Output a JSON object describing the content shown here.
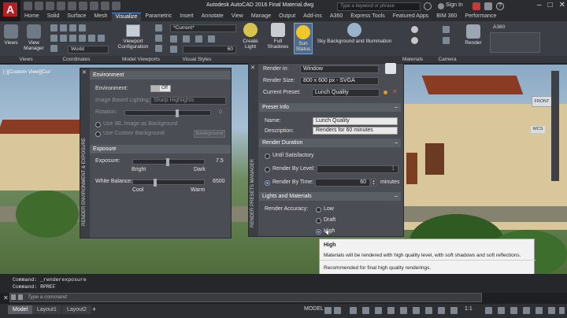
{
  "title": {
    "text": "Autodesk AutoCAD 2016    Final Material.dwg",
    "search_placeholder": "Type a keyword or phrase",
    "signin": "Sign In",
    "logo": "A"
  },
  "ribbon_tabs": [
    "Home",
    "Solid",
    "Surface",
    "Mesh",
    "Visualize",
    "Parametric",
    "Insert",
    "Annotate",
    "View",
    "Manage",
    "Output",
    "Add-ins",
    "A360",
    "Express Tools",
    "Featured Apps",
    "BIM 360",
    "Performance"
  ],
  "ribbon": {
    "views_btn": "Views",
    "view_manager_btn": [
      "View",
      "Manager"
    ],
    "world_select": "World",
    "viewport_config_btn": [
      "Viewport",
      "Configuration"
    ],
    "current_select": "*Current*",
    "shadow_value": "60",
    "create_light_btn": [
      "Create",
      "Light"
    ],
    "full_shadows_btn": [
      "Full",
      "Shadows"
    ],
    "sun_status_btn": [
      "Sun",
      "Status"
    ],
    "sky_btn": "Sky Background and Illumination",
    "render_btn": "Render",
    "a360_label": "A360",
    "groups": {
      "views": "Views",
      "coordinates": "Coordinates",
      "model_viewports": "Model Viewports",
      "visual_styles": "Visual Styles",
      "materials": "Materials",
      "camera": "Camera"
    }
  },
  "viewport": {
    "label": "[-][Custom View][Cur",
    "viewcube_label": "FRONT",
    "wcs_label": "WCS"
  },
  "render_env": {
    "side_title": "RENDER ENVIRONMENT & EXPOSURE",
    "environment_section": "Environment",
    "environment_label": "Environment:",
    "environment_toggle": "Off",
    "ibl_label": "Image Based Lighting:",
    "ibl_value": "Sharp Highlights",
    "rotation_label": "Rotation:",
    "rotation_value": "0",
    "use_ibl_bg": "Use IBL Image as Background",
    "use_custom_bg": "Use Custom Background",
    "background_btn": "Background",
    "exposure_section": "Exposure",
    "exposure_label": "Exposure:",
    "exposure_value": "7.5",
    "bright": "Bright",
    "dark": "Dark",
    "white_balance_label": "White Balance:",
    "white_balance_value": "6500",
    "cool": "Cool",
    "warm": "Warm"
  },
  "render_presets": {
    "side_title": "RENDER PRESETS MANAGER",
    "render_in_label": "Render in:",
    "render_in_value": "Window",
    "render_size_label": "Render Size:",
    "render_size_value": "800 x 600 px - SVGA",
    "current_preset_label": "Current Preset:",
    "current_preset_value": "Lunch Quality",
    "preset_info_section": "Preset Info",
    "name_label": "Name:",
    "name_value": "Lunch Quality",
    "description_label": "Description:",
    "description_value": "Renders for 60 minutes",
    "render_duration_section": "Render Duration",
    "until_satisfactory": "Until Satisfactory",
    "render_by_level": "Render By Level:",
    "render_by_level_value": "1",
    "render_by_time": "Render By Time:",
    "render_by_time_value": "60",
    "minutes": "minutes",
    "lights_section": "Lights and Materials",
    "accuracy_label": "Render Accuracy:",
    "low": "Low",
    "draft": "Draft",
    "high": "High"
  },
  "tooltip": {
    "title": "High",
    "line1": "Materials will be rendered with high quality level, with soft shadows and soft reflections.",
    "line2": "Recommended for final high quality renderings."
  },
  "command": {
    "history": [
      "Command:  _renderexposure",
      "Command:  RPREF"
    ],
    "placeholder": "Type a command"
  },
  "status": {
    "tabs": [
      "Model",
      "Layout1",
      "Layout2"
    ],
    "model_label": "MODEL",
    "scale": "1:1"
  },
  "icons": [
    "search-icon",
    "gear-icon",
    "sun-icon",
    "lightbulb-icon",
    "render-icon",
    "teapot-icon",
    "close-icon",
    "plus-icon"
  ]
}
